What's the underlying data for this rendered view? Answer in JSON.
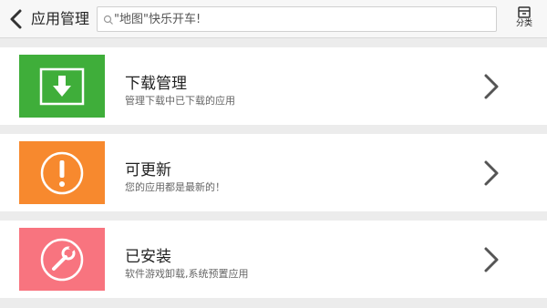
{
  "header": {
    "title": "应用管理",
    "search_placeholder": "\"地图\"快乐开车!",
    "category_label": "分类"
  },
  "items": [
    {
      "title": "下载管理",
      "subtitle": "管理下载中已下载的应用",
      "icon": "download-icon",
      "color": "#3fae3a"
    },
    {
      "title": "可更新",
      "subtitle": "您的应用都是最新的！",
      "icon": "exclamation-icon",
      "color": "#f7892e"
    },
    {
      "title": "已安装",
      "subtitle": "软件游戏卸载,系统预置应用",
      "icon": "wrench-icon",
      "color": "#f8747f"
    }
  ]
}
